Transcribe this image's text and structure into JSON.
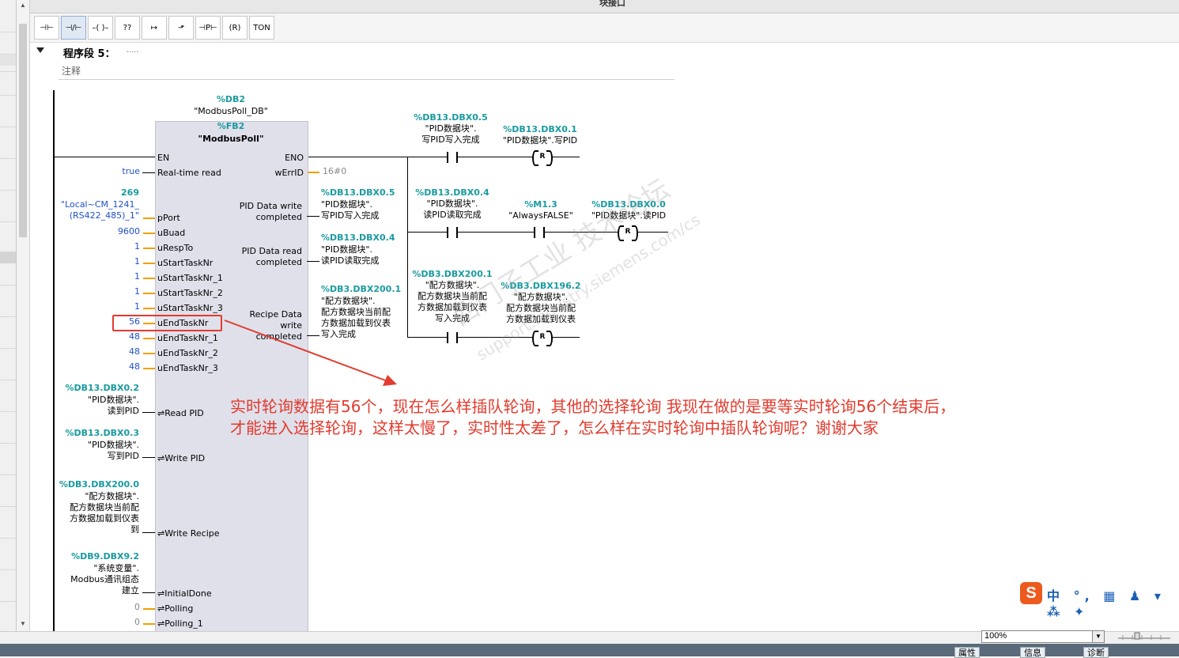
{
  "window": {
    "title": "块接口"
  },
  "toolbar": {
    "buttons": [
      {
        "name": "no-contact",
        "glyph": "⊣⊢"
      },
      {
        "name": "nc-contact",
        "glyph": "⊣/⊢"
      },
      {
        "name": "coil",
        "glyph": "–( )–"
      },
      {
        "name": "empty-box",
        "glyph": "??"
      },
      {
        "name": "open-branch",
        "glyph": "↦"
      },
      {
        "name": "close-branch",
        "glyph": "⬏"
      },
      {
        "name": "p-contact",
        "glyph": "⊣P⊢"
      },
      {
        "name": "reset-coil",
        "glyph": "(R)"
      },
      {
        "name": "ton-timer",
        "glyph": "TON"
      }
    ]
  },
  "network": {
    "label": "程序段 5：",
    "dots": ".....",
    "comment": "注释"
  },
  "block": {
    "db_addr": "%DB2",
    "db_name": "\"ModbusPoll_DB\"",
    "fb_addr": "%FB2",
    "fb_name": "\"ModbusPoll\"",
    "inputs": [
      {
        "pin": "EN",
        "value": ""
      },
      {
        "pin": "Real-time read",
        "value": "true"
      },
      {
        "pin": "pPort",
        "value": "269",
        "value2": "\"Local~CM_1241_",
        "value3": "(RS422_485)_1\""
      },
      {
        "pin": "uBuad",
        "value": "9600"
      },
      {
        "pin": "uRespTo",
        "value": "1"
      },
      {
        "pin": "uStartTaskNr",
        "value": "1"
      },
      {
        "pin": "uStartTaskNr_1",
        "value": "1"
      },
      {
        "pin": "uStartTaskNr_2",
        "value": "1"
      },
      {
        "pin": "uStartTaskNr_3",
        "value": "1"
      },
      {
        "pin": "uEndTaskNr",
        "value": "56"
      },
      {
        "pin": "uEndTaskNr_1",
        "value": "48"
      },
      {
        "pin": "uEndTaskNr_2",
        "value": "48"
      },
      {
        "pin": "uEndTaskNr_3",
        "value": "48"
      }
    ],
    "inouts": [
      {
        "pin": "⇌Read PID",
        "addr": "%DB13.DBX0.2",
        "l1": "\"PID数据块\".",
        "l2": "读到PID"
      },
      {
        "pin": "⇌Write PID",
        "addr": "%DB13.DBX0.3",
        "l1": "\"PID数据块\".",
        "l2": "写到PID"
      },
      {
        "pin": "⇌Write Recipe",
        "addr": "%DB3.DBX200.0",
        "l1": "\"配方数据块\".",
        "l2": "配方数据块当前配",
        "l3": "方数据加载到仪表",
        "l4": "到"
      },
      {
        "pin": "⇌InitialDone",
        "addr": "%DB9.DBX9.2",
        "l1": "\"系统变量\".",
        "l2": "Modbus通讯组态",
        "l3": "建立"
      },
      {
        "pin": "⇌Polling",
        "value": "0"
      },
      {
        "pin": "⇌Polling_1",
        "value": "0"
      }
    ],
    "outputs": [
      {
        "pin": "ENO"
      },
      {
        "pin": "wErrID",
        "value": "16#0"
      },
      {
        "pin1": "PID Data write",
        "pin2": "completed",
        "addr": "%DB13.DBX0.5",
        "l1": "\"PID数据块\".",
        "l2": "写PID写入完成"
      },
      {
        "pin1": "PID  Data read",
        "pin2": "completed",
        "addr": "%DB13.DBX0.4",
        "l1": "\"PID数据块\".",
        "l2": "读PID读取完成"
      },
      {
        "pin1": "Recipe  Data",
        "pin2": "write",
        "pin3": "completed",
        "addr": "%DB3.DBX200.1",
        "l1": "\"配方数据块\".",
        "l2": "配方数据块当前配",
        "l3": "方数据加载到仪表",
        "l4": "写入完成"
      }
    ]
  },
  "rungs": [
    {
      "c_addr": "%DB13.DBX0.5",
      "c_l1": "\"PID数据块\".",
      "c_l2": "写PID写入完成",
      "coil_addr": "%DB13.DBX0.1",
      "coil_l1": "\"PID数据块\".写PID",
      "coil_type": "R"
    },
    {
      "c_addr": "%DB13.DBX0.4",
      "c_l1": "\"PID数据块\".",
      "c_l2": "读PID读取完成",
      "c2_addr": "%M1.3",
      "c2_l1": "\"AlwaysFALSE\"",
      "coil_addr": "%DB13.DBX0.0",
      "coil_l1": "\"PID数据块\".读PID",
      "coil_type": "R"
    },
    {
      "c_addr": "%DB3.DBX200.1",
      "c_l1": "\"配方数据块\".",
      "c_l2": "配方数据块当前配",
      "c_l3": "方数据加载到仪表",
      "c_l4": "写入完成",
      "coil_addr": "%DB3.DBX196.2",
      "coil_l1": "\"配方数据块\".",
      "coil_l2": "配方数据块当前配",
      "coil_l3": "方数据加载到仪表",
      "coil_type": "R"
    }
  ],
  "annotation": {
    "line1": "实时轮询数据有56个，现在怎么样插队轮询，其他的选择轮询  我现在做的是要等实时轮询56个结束后，",
    "line2": "才能进入选择轮询，这样太慢了，实时性太差了，怎么样在实时轮询中插队轮询呢？谢谢大家"
  },
  "watermark": {
    "l1": "西门子工业  技术论坛",
    "l2": "support.industry.siemens.com/cs"
  },
  "ime": {
    "logo": "S",
    "items": "中 °, ▦ ♟ ▾ ⁂ ✦"
  },
  "bottom": {
    "zoom": "100%",
    "tabs": [
      "属性",
      "信息",
      "诊断"
    ]
  },
  "colors": {
    "accent_teal": "#1a9aa0",
    "value_blue": "#2050c8",
    "annotation_red": "#e23b2e",
    "wire_orange": "#f0a000"
  }
}
